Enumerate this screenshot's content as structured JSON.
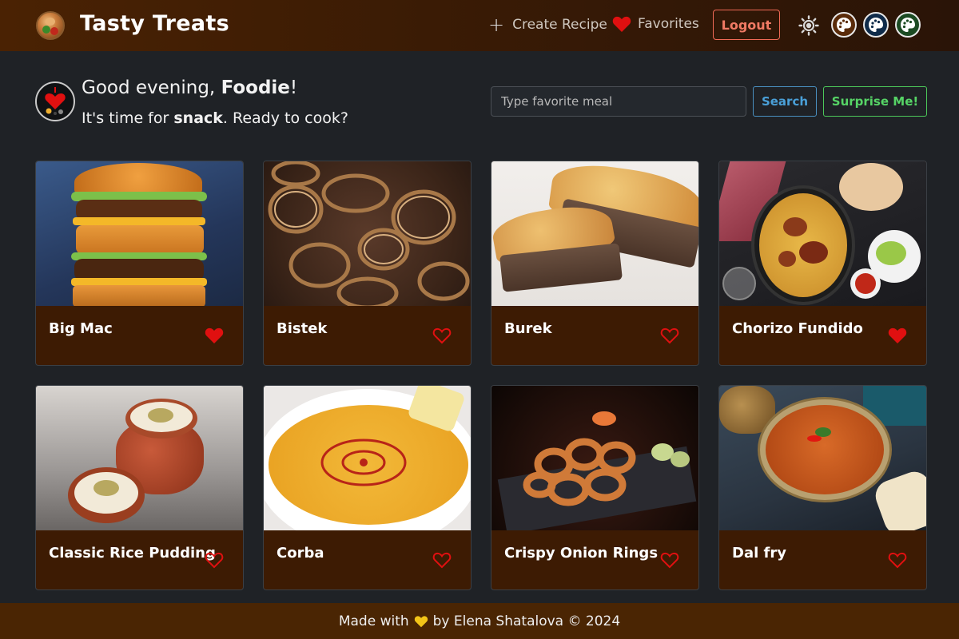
{
  "header": {
    "app_title": "Tasty Treats",
    "create_label": "Create Recipe",
    "favorites_label": "Favorites",
    "logout_label": "Logout"
  },
  "greeting": {
    "line1_prefix": "Good evening, ",
    "user_name": "Foodie",
    "line1_suffix": "!",
    "line2_prefix": "It's time for ",
    "meal": "snack",
    "line2_suffix": ". Ready to cook?"
  },
  "search": {
    "placeholder": "Type favorite meal",
    "search_label": "Search",
    "surprise_label": "Surprise Me!"
  },
  "recipes": [
    {
      "name": "Big Mac",
      "favorite": true
    },
    {
      "name": "Bistek",
      "favorite": false
    },
    {
      "name": "Burek",
      "favorite": false
    },
    {
      "name": "Chorizo Fundido",
      "favorite": true
    },
    {
      "name": "Classic Rice Pudding",
      "favorite": false
    },
    {
      "name": "Corba",
      "favorite": false
    },
    {
      "name": "Crispy Onion Rings",
      "favorite": false
    },
    {
      "name": "Dal fry",
      "favorite": false
    }
  ],
  "footer": {
    "prefix": "Made with",
    "suffix": "by Elena Shatalova © 2024"
  },
  "colors": {
    "header_bg": "#4a2203",
    "card_bg": "#3d1b03",
    "footer_bg": "#4a2503",
    "heart": "#e01010",
    "logout": "#f06a56",
    "search_btn": "#4aa0d8",
    "surprise_btn": "#56d466"
  },
  "icons": {
    "logo": "food-plate-icon",
    "create": "plus-icon",
    "favorites": "heart-icon",
    "theme": "sun-icon",
    "palettes": [
      "palette-icon",
      "palette-icon",
      "palette-icon"
    ],
    "avatar": "heart-chef-icon",
    "footer": "yellow-heart-icon"
  }
}
